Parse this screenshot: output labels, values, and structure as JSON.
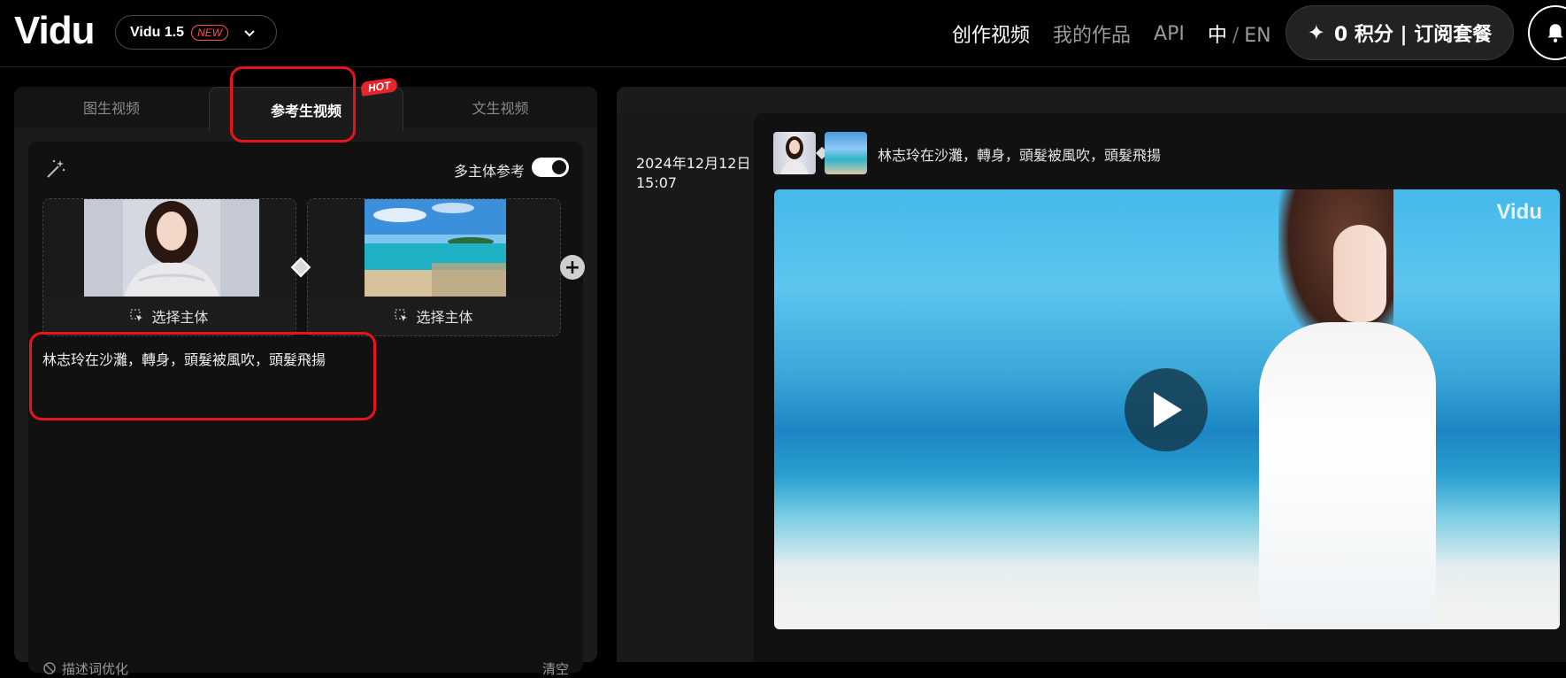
{
  "header": {
    "logo": "Vidu",
    "model": {
      "name": "Vidu 1.5",
      "badge": "NEW"
    },
    "nav": [
      {
        "label": "创作视频",
        "active": true
      },
      {
        "label": "我的作品",
        "active": false
      },
      {
        "label": "API",
        "active": false
      }
    ],
    "lang": {
      "zh": "中",
      "sep": "/",
      "en": "EN"
    },
    "credits_label": "0 积分 | 订阅套餐"
  },
  "left": {
    "tabs": [
      {
        "label": "图生视频",
        "active": false
      },
      {
        "label": "参考生视频",
        "active": true
      },
      {
        "label": "文生视频",
        "active": false
      }
    ],
    "hot_badge": "HOT",
    "multi_subject_label": "多主体参考",
    "multi_subject_on": true,
    "subjects": [
      {
        "select_label": "选择主体"
      },
      {
        "select_label": "选择主体"
      }
    ],
    "prompt": "林志玲在沙灘，轉身，頭髮被風吹，頭髮飛揚",
    "footer": {
      "optimize_label": "描述词优化",
      "clear_label": "清空"
    }
  },
  "right": {
    "entry": {
      "date": "2024年12月12日",
      "time": "15:07",
      "prompt": "林志玲在沙灘，轉身，頭髮被風吹，頭髮飛揚",
      "watermark": "Vidu"
    }
  },
  "colors": {
    "accent_red": "#e8141b",
    "panel_bg": "#1b1b1b",
    "card_bg": "#111111"
  }
}
